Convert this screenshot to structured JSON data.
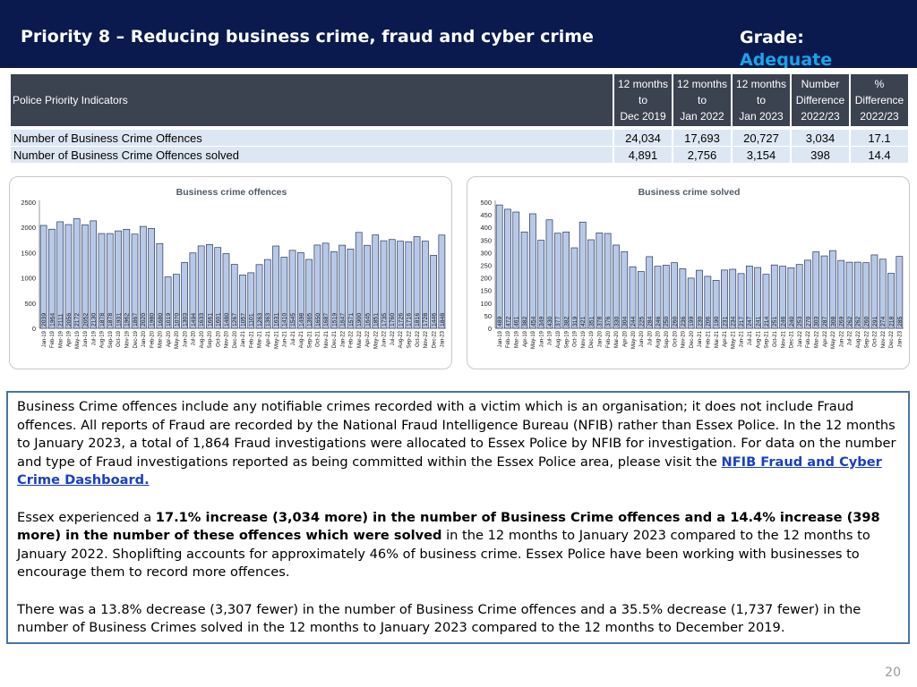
{
  "header": {
    "title": "Priority 8 – Reducing business crime, fraud and cyber crime",
    "grade_label": "Grade:",
    "grade_value": "Adequate"
  },
  "table": {
    "columns": [
      "Police Priority Indicators",
      [
        "12 months",
        "to",
        "Dec 2019"
      ],
      [
        "12 months",
        "to",
        "Jan 2022"
      ],
      [
        "12 months",
        "to",
        "Jan 2023"
      ],
      [
        "Number",
        "Difference",
        "2022/23"
      ],
      [
        "%",
        "Difference",
        "2022/23"
      ]
    ],
    "rows": [
      [
        "Number of Business Crime Offences",
        "24,034",
        "17,693",
        "20,727",
        "3,034",
        "17.1"
      ],
      [
        "Number of Business Crime Offences solved",
        "4,891",
        "2,756",
        "3,154",
        "398",
        "14.4"
      ]
    ]
  },
  "chart_data": [
    {
      "type": "bar",
      "title": "Business crime offences",
      "ylim": [
        0,
        2500
      ],
      "yticks": [
        0,
        500,
        1000,
        1500,
        2000,
        2500
      ],
      "grid": false,
      "bar_color": "#b8c9e8",
      "bar_edge": "#2a3558",
      "categories": [
        "Jan-19",
        "Feb-19",
        "Mar-19",
        "Apr-19",
        "May-19",
        "Jun-19",
        "Jul-19",
        "Aug-19",
        "Sep-19",
        "Oct-19",
        "Nov-19",
        "Dec-19",
        "Jan-20",
        "Feb-20",
        "Mar-20",
        "Apr-20",
        "May-20",
        "Jun-20",
        "Jul-20",
        "Aug-20",
        "Sep-20",
        "Oct-20",
        "Nov-20",
        "Dec-20",
        "Jan-21",
        "Feb-21",
        "Mar-21",
        "Apr-21",
        "May-21",
        "Jun-21",
        "Jul-21",
        "Aug-21",
        "Sep-21",
        "Oct-21",
        "Nov-21",
        "Dec-21",
        "Jan-22",
        "Feb-22",
        "Mar-22",
        "Apr-22",
        "May-22",
        "Jun-22",
        "Jul-22",
        "Aug-22",
        "Sep-22",
        "Oct-22",
        "Nov-22",
        "Dec-22",
        "Jan-23"
      ],
      "values": [
        2039,
        1964,
        2111,
        2056,
        2172,
        2052,
        2130,
        1878,
        1878,
        1931,
        1962,
        1867,
        2020,
        1980,
        1680,
        1019,
        1070,
        1303,
        1494,
        1633,
        1661,
        1601,
        1480,
        1267,
        1057,
        1101,
        1263,
        1363,
        1631,
        1410,
        1545,
        1498,
        1365,
        1650,
        1687,
        1519,
        1647,
        1571,
        1900,
        1645,
        1851,
        1735,
        1760,
        1726,
        1716,
        1816,
        1728,
        1446,
        1848
      ]
    },
    {
      "type": "bar",
      "title": "Business crime solved",
      "ylim": [
        0,
        500
      ],
      "yticks": [
        0,
        50,
        100,
        150,
        200,
        250,
        300,
        350,
        400,
        450,
        500
      ],
      "grid": false,
      "bar_color": "#b8c9e8",
      "bar_edge": "#2a3558",
      "categories": [
        "Jan-19",
        "Feb-19",
        "Mar-19",
        "Apr-19",
        "May-19",
        "Jun-19",
        "Jul-19",
        "Aug-19",
        "Sep-19",
        "Oct-19",
        "Nov-19",
        "Dec-19",
        "Jan-20",
        "Feb-20",
        "Mar-20",
        "Apr-20",
        "May-20",
        "Jun-20",
        "Jul-20",
        "Aug-20",
        "Sep-20",
        "Oct-20",
        "Nov-20",
        "Dec-20",
        "Jan-21",
        "Feb-21",
        "Mar-21",
        "Apr-21",
        "May-21",
        "Jun-21",
        "Jul-21",
        "Aug-21",
        "Sep-21",
        "Oct-21",
        "Nov-21",
        "Dec-21",
        "Jan-22",
        "Feb-22",
        "Mar-22",
        "Apr-22",
        "May-22",
        "Jun-22",
        "Jul-22",
        "Aug-22",
        "Sep-22",
        "Oct-22",
        "Nov-22",
        "Dec-22",
        "Jan-23"
      ],
      "values": [
        489,
        472,
        461,
        382,
        454,
        349,
        430,
        377,
        382,
        319,
        421,
        351,
        378,
        376,
        330,
        304,
        244,
        225,
        284,
        246,
        250,
        260,
        236,
        199,
        230,
        206,
        190,
        231,
        234,
        217,
        247,
        241,
        214,
        251,
        246,
        240,
        253,
        270,
        303,
        287,
        308,
        269,
        262,
        262,
        260,
        291,
        274,
        218,
        285
      ]
    }
  ],
  "text": {
    "p1": "Business Crime offences include any notifiable crimes recorded with a victim which is an organisation; it does not include Fraud offences. All reports of Fraud are recorded by the National Fraud Intelligence Bureau (NFIB) rather than Essex Police. In the 12 months to January 2023, a total of 1,864 Fraud investigations were allocated to Essex Police by NFIB for investigation. For data on the number and type of Fraud investigations reported as being committed within the Essex Police area, please visit the ",
    "link": "NFIB Fraud and Cyber Crime Dashboard.",
    "p2_a": "Essex experienced a ",
    "p2_bold": "17.1% increase (3,034 more) in the number of Business Crime offences and a 14.4% increase (398 more) in the number of these offences which were solved",
    "p2_b": " in the 12 months to January 2023 compared to the 12 months to January 2022. Shoplifting accounts for approximately 46% of business crime. Essex Police have been working with businesses to encourage them to record more offences.",
    "p3": "There was a 13.8% decrease (3,307 fewer) in the number of Business Crime offences and a 35.5% decrease (1,737 fewer) in the number of Business Crimes solved in the 12 months to January 2023 compared to the 12 months to December 2019."
  },
  "page_number": "20"
}
